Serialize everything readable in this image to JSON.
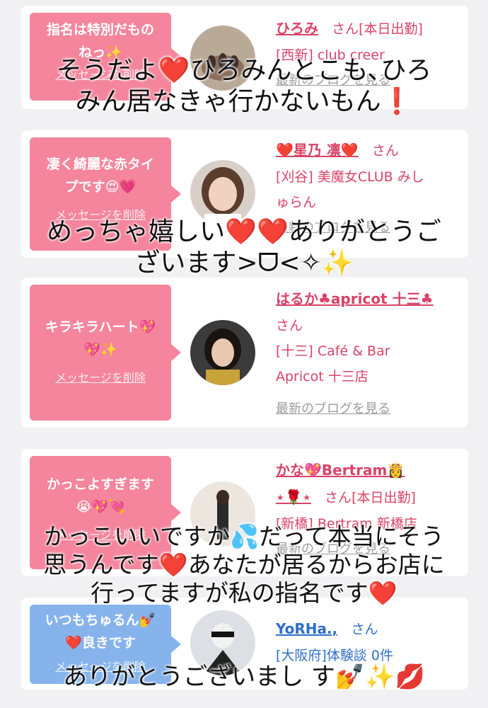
{
  "colors": {
    "pink_bubble": "#f4859c",
    "blue_bubble": "#86b3ec",
    "name_pink": "#d94367",
    "name_blue": "#2e6fc6",
    "link_gray": "#9a9a9a"
  },
  "delete_link_label": "メッセージを削除",
  "blog_link_label": "最新のブログを見る",
  "cards": [
    {
      "message_line1": "指名は特別だもの",
      "message_line2": "ねっ✨",
      "name": "ひろみ",
      "san": "さん",
      "shift": "[本日出勤]",
      "shop": "[西新] club creer"
    },
    {
      "message_line1": "凄く綺麗な赤タイ",
      "message_line2": "プです😍💗",
      "name": "❤️星乃 凛❤️",
      "san": "さん",
      "shop_line1": "[刈谷] 美魔女CLUB みし",
      "shop_line2": "ゅらん"
    },
    {
      "message_line1": "キラキラハート💖",
      "message_line2": "💖✨",
      "name": "はるか♣apricot 十三♣",
      "san": "さん",
      "shop_line1": "[十三] Café & Bar",
      "shop_line2": "Apricot 十三店"
    },
    {
      "message_line1": "かっこよすぎます",
      "message_line2": "😭💖💘",
      "name": "かな💖Bertram👸",
      "name_line2": "⋆🌹⋆",
      "san": "さん",
      "shift": "[本日出勤]",
      "shop": "[新橋] Bertram 新橋店"
    },
    {
      "message_line1": "いつもちゅるん💅",
      "message_line2": "❤️良きです",
      "name": "YoRHa.,",
      "san": "さん",
      "shop": "[大阪府]体験談 0件"
    }
  ],
  "overlay_texts": {
    "t1_line1": "そうだよ❤️ひろみんとこも､ひろ",
    "t1_line2": "みん居なきゃ行かないもん❗",
    "t2_line1": "めっちゃ嬉しい❤️❤️ありがとうご",
    "t2_line2": "ざいます>ᗜ<✧✨",
    "t3_line1": "かっこいいですか💦だって本当にそう",
    "t3_line2": "思うんです❤️あなたが居るからお店に",
    "t3_line3": "行ってますが私の指名です❤️",
    "t4_line1": "ありがとうございまし す💅✨💋"
  }
}
